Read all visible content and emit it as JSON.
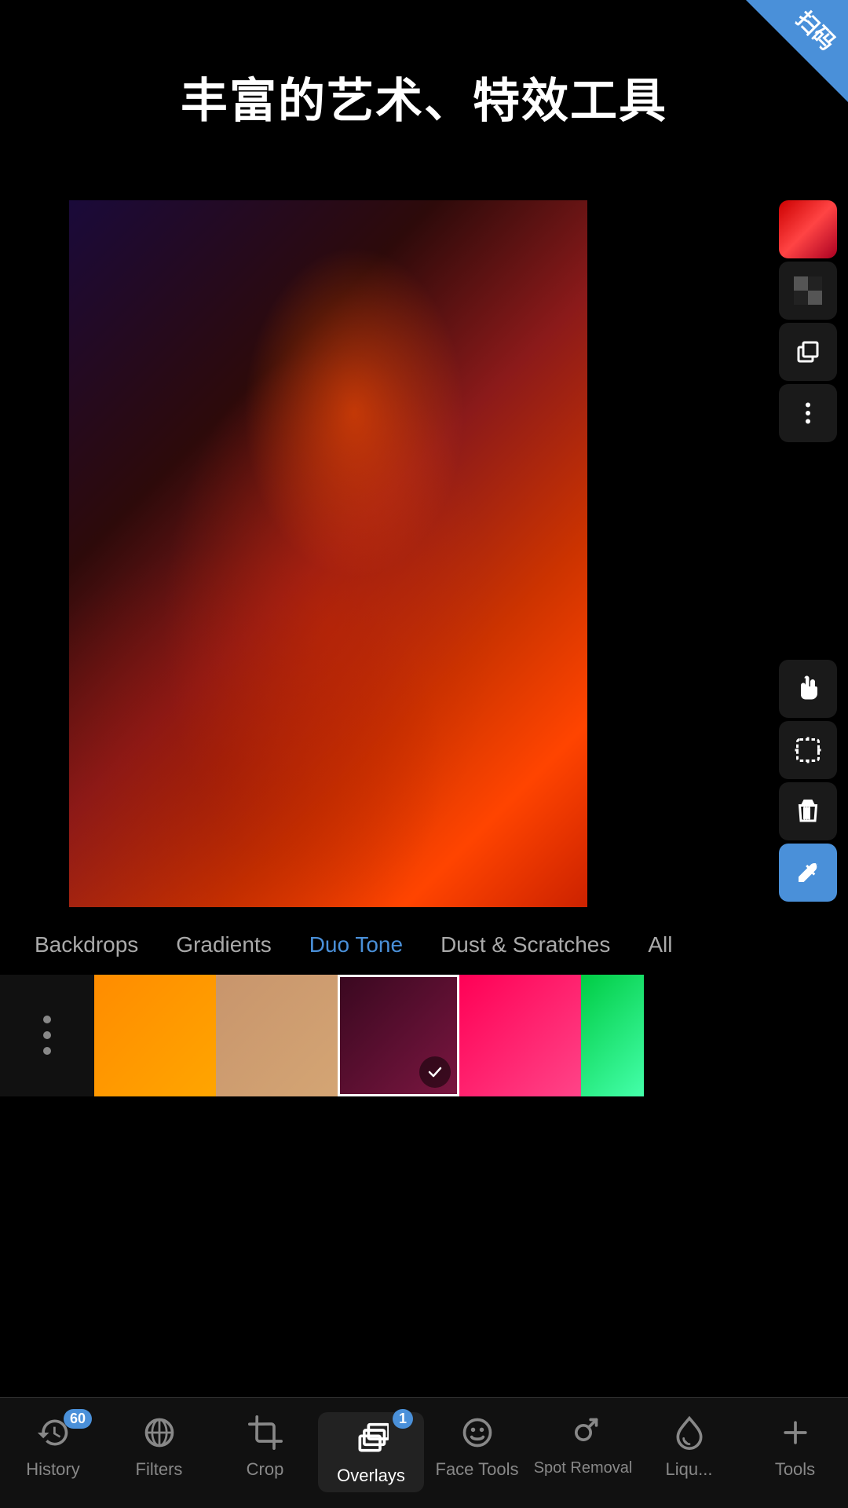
{
  "corner_badge": {
    "text": "扫码"
  },
  "page_title": "丰富的艺术、特效工具",
  "filter_tabs": [
    {
      "label": "",
      "active": false
    },
    {
      "label": "Backdrops",
      "active": false
    },
    {
      "label": "Gradients",
      "active": false
    },
    {
      "label": "Duo Tone",
      "active": true
    },
    {
      "label": "Dust & Scratches",
      "active": false
    },
    {
      "label": "All",
      "active": false
    }
  ],
  "swatches": [
    {
      "type": "menu",
      "color": ""
    },
    {
      "type": "solid",
      "color": "linear-gradient(135deg, #ff8c00 0%, #ffa500 100%)"
    },
    {
      "type": "solid",
      "color": "linear-gradient(135deg, #c8956c 0%, #d4a574 100%)"
    },
    {
      "type": "solid",
      "color": "linear-gradient(135deg, #4a0a2a 0%, #8b1a4a 100%)"
    },
    {
      "type": "solid",
      "color": "linear-gradient(135deg, #ff0055 0%, #ff4488 100%)"
    },
    {
      "type": "partial",
      "color": "linear-gradient(135deg, #00cc44 0%, #44ffaa 100%)"
    }
  ],
  "bottom_nav": {
    "items": [
      {
        "id": "history",
        "label": "History",
        "badge": "60",
        "active": false
      },
      {
        "id": "filters",
        "label": "Filters",
        "badge": "",
        "active": false
      },
      {
        "id": "crop",
        "label": "Crop",
        "badge": "",
        "active": false
      },
      {
        "id": "overlays",
        "label": "Overlays",
        "badge": "1",
        "active": true
      },
      {
        "id": "face-tools",
        "label": "Face Tools",
        "badge": "",
        "active": false
      },
      {
        "id": "spot-removal",
        "label": "Spot Removal",
        "badge": "",
        "active": false
      },
      {
        "id": "liquify",
        "label": "Liqu...",
        "badge": "",
        "active": false
      },
      {
        "id": "tools",
        "label": "Tools",
        "badge": "",
        "active": false
      }
    ]
  },
  "toolbar_upper": [
    {
      "id": "color",
      "type": "color-swatch",
      "label": "color-picker"
    },
    {
      "id": "checker",
      "type": "icon",
      "label": "transparency"
    },
    {
      "id": "duplicate",
      "type": "icon",
      "label": "duplicate"
    },
    {
      "id": "more",
      "type": "icon",
      "label": "more-options"
    }
  ],
  "toolbar_lower": [
    {
      "id": "hand",
      "type": "icon",
      "label": "hand-tool"
    },
    {
      "id": "select",
      "type": "icon",
      "label": "select-tool"
    },
    {
      "id": "delete",
      "type": "icon",
      "label": "delete"
    },
    {
      "id": "eyedropper",
      "type": "icon",
      "label": "eyedropper",
      "active": true
    }
  ]
}
